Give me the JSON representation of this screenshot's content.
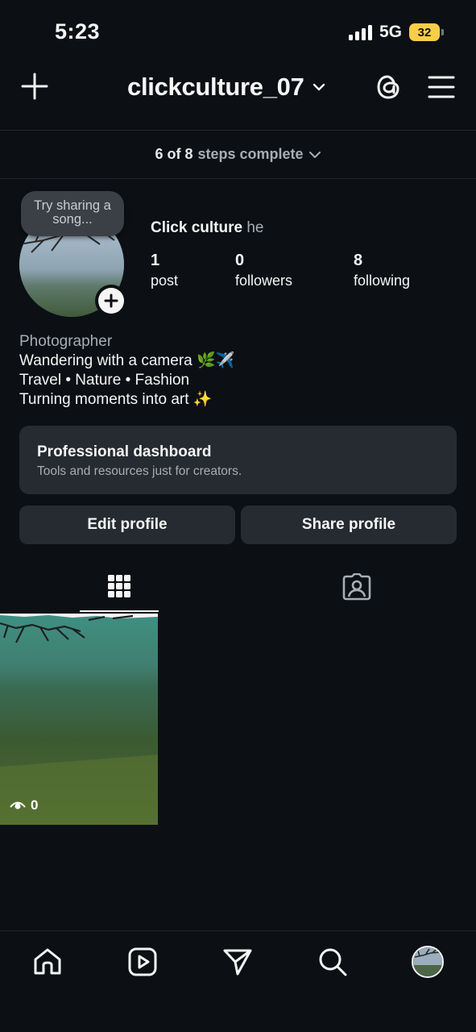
{
  "status_bar": {
    "time": "5:23",
    "network": "5G",
    "battery": "32",
    "battery_color": "#f7ce46"
  },
  "header": {
    "username": "clickculture_07",
    "icons": [
      "plus-icon",
      "chevron-down-icon",
      "threads-icon",
      "menu-icon"
    ]
  },
  "steps": {
    "count": "6 of 8",
    "text": "steps complete"
  },
  "profile": {
    "note": "Try sharing a song...",
    "name": "Click culture",
    "pronouns": "he",
    "stats": [
      {
        "value": "1",
        "label": "post"
      },
      {
        "value": "0",
        "label": "followers"
      },
      {
        "value": "8",
        "label": "following"
      }
    ],
    "bio": {
      "category": "Photographer",
      "line1": "Wandering with a camera 🌿✈️",
      "line2": "Travel • Nature • Fashion",
      "line3": "Turning moments into art ✨"
    }
  },
  "dashboard": {
    "title": "Professional dashboard",
    "subtitle": "Tools and resources just for creators."
  },
  "buttons": {
    "edit": "Edit profile",
    "share": "Share profile"
  },
  "tabs": [
    {
      "icon": "grid-icon",
      "active": true
    },
    {
      "icon": "tagged-icon",
      "active": false
    }
  ],
  "posts": [
    {
      "views": "0"
    }
  ],
  "bottom_nav": [
    "home-icon",
    "reels-icon",
    "send-icon",
    "search-icon",
    "profile-avatar"
  ],
  "colors": {
    "background": "#0c1014",
    "surface": "#262a31",
    "muted_text": "#a8adb3"
  }
}
